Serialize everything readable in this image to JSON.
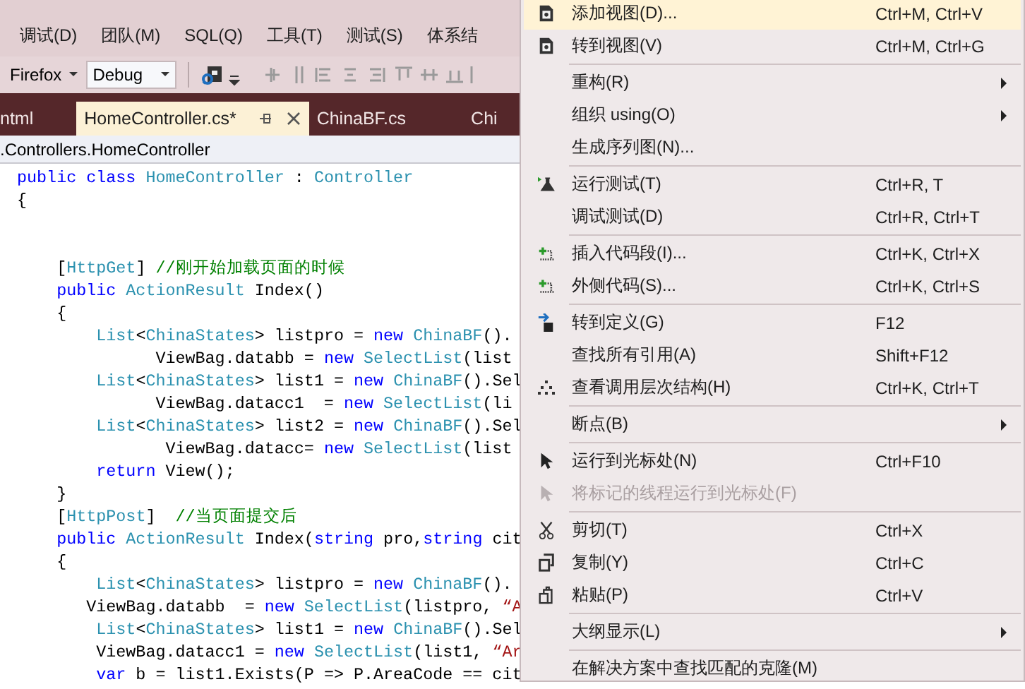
{
  "menu_bar": [
    "调试(D)",
    "团队(M)",
    "SQL(Q)",
    "工具(T)",
    "测试(S)",
    "体系结"
  ],
  "toolbar": {
    "browser": "Firefox",
    "configuration": "Debug"
  },
  "tabs": [
    {
      "label": "ntml",
      "selected": false
    },
    {
      "label": "HomeController.cs*",
      "selected": true
    },
    {
      "label": "ChinaBF.cs",
      "selected": false
    },
    {
      "label": "Chi",
      "selected": false
    }
  ],
  "breadcrumb": ".Controllers.HomeController",
  "code_lines": [
    {
      "tokens": [
        {
          "kind": "keyword",
          "text": " public class "
        },
        {
          "kind": "type",
          "text": "HomeController"
        },
        {
          "kind": "plain",
          "text": " : "
        },
        {
          "kind": "type",
          "text": "Controller"
        }
      ]
    },
    {
      "tokens": [
        {
          "kind": "plain",
          "text": " {"
        }
      ]
    },
    {
      "gap_before": true,
      "tokens": [
        {
          "kind": "plain",
          "text": "     ["
        },
        {
          "kind": "type",
          "text": "HttpGet"
        },
        {
          "kind": "plain",
          "text": "] "
        },
        {
          "kind": "comment",
          "text": "//刚开始加载页面的时候"
        }
      ]
    },
    {
      "tokens": [
        {
          "kind": "keyword",
          "text": "     public "
        },
        {
          "kind": "type",
          "text": "ActionResult"
        },
        {
          "kind": "plain",
          "text": " Index()"
        }
      ]
    },
    {
      "tokens": [
        {
          "kind": "plain",
          "text": "     {"
        }
      ]
    },
    {
      "tokens": [
        {
          "kind": "type",
          "text": "         List"
        },
        {
          "kind": "plain",
          "text": "<"
        },
        {
          "kind": "type",
          "text": "ChinaStates"
        },
        {
          "kind": "plain",
          "text": "> listpro = "
        },
        {
          "kind": "keyword",
          "text": "new "
        },
        {
          "kind": "type",
          "text": "ChinaBF"
        },
        {
          "kind": "plain",
          "text": "()."
        }
      ]
    },
    {
      "tokens": [
        {
          "kind": "plain",
          "text": "               ViewBag.databb = "
        },
        {
          "kind": "keyword",
          "text": "new "
        },
        {
          "kind": "type",
          "text": "SelectList"
        },
        {
          "kind": "plain",
          "text": "(list"
        }
      ]
    },
    {
      "tokens": [
        {
          "kind": "type",
          "text": "         List"
        },
        {
          "kind": "plain",
          "text": "<"
        },
        {
          "kind": "type",
          "text": "ChinaStates"
        },
        {
          "kind": "plain",
          "text": "> list1 = "
        },
        {
          "kind": "keyword",
          "text": "new "
        },
        {
          "kind": "type",
          "text": "ChinaBF"
        },
        {
          "kind": "plain",
          "text": "().Sel"
        }
      ]
    },
    {
      "tokens": [
        {
          "kind": "plain",
          "text": "               ViewBag.datacc1  = "
        },
        {
          "kind": "keyword",
          "text": "new "
        },
        {
          "kind": "type",
          "text": "SelectList"
        },
        {
          "kind": "plain",
          "text": "(li"
        }
      ]
    },
    {
      "tokens": [
        {
          "kind": "type",
          "text": "         List"
        },
        {
          "kind": "plain",
          "text": "<"
        },
        {
          "kind": "type",
          "text": "ChinaStates"
        },
        {
          "kind": "plain",
          "text": "> list2 = "
        },
        {
          "kind": "keyword",
          "text": "new "
        },
        {
          "kind": "type",
          "text": "ChinaBF"
        },
        {
          "kind": "plain",
          "text": "().Sel"
        }
      ]
    },
    {
      "tokens": [
        {
          "kind": "plain",
          "text": "                ViewBag.datacc= "
        },
        {
          "kind": "keyword",
          "text": "new "
        },
        {
          "kind": "type",
          "text": "SelectList"
        },
        {
          "kind": "plain",
          "text": "(list"
        }
      ]
    },
    {
      "tokens": [
        {
          "kind": "keyword",
          "text": "         return"
        },
        {
          "kind": "plain",
          "text": " View();"
        }
      ]
    },
    {
      "tokens": [
        {
          "kind": "plain",
          "text": "     }"
        }
      ]
    },
    {
      "tokens": [
        {
          "kind": "plain",
          "text": "     ["
        },
        {
          "kind": "type",
          "text": "HttpPost"
        },
        {
          "kind": "plain",
          "text": "]  "
        },
        {
          "kind": "comment",
          "text": "//当页面提交后"
        }
      ]
    },
    {
      "tokens": [
        {
          "kind": "keyword",
          "text": "     public "
        },
        {
          "kind": "type",
          "text": "ActionResult"
        },
        {
          "kind": "plain",
          "text": " Index("
        },
        {
          "kind": "keyword",
          "text": "string"
        },
        {
          "kind": "plain",
          "text": " pro,"
        },
        {
          "kind": "keyword",
          "text": "string"
        },
        {
          "kind": "plain",
          "text": " cit"
        }
      ]
    },
    {
      "tokens": [
        {
          "kind": "plain",
          "text": "     {"
        }
      ]
    },
    {
      "tokens": [
        {
          "kind": "type",
          "text": "         List"
        },
        {
          "kind": "plain",
          "text": "<"
        },
        {
          "kind": "type",
          "text": "ChinaStates"
        },
        {
          "kind": "plain",
          "text": "> listpro = "
        },
        {
          "kind": "keyword",
          "text": "new "
        },
        {
          "kind": "type",
          "text": "ChinaBF"
        },
        {
          "kind": "plain",
          "text": "()."
        }
      ]
    },
    {
      "tokens": [
        {
          "kind": "plain",
          "text": "        ViewBag.databb  = "
        },
        {
          "kind": "keyword",
          "text": "new "
        },
        {
          "kind": "type",
          "text": "SelectList"
        },
        {
          "kind": "plain",
          "text": "(listpro, "
        },
        {
          "kind": "string",
          "text": "“A"
        }
      ]
    },
    {
      "tokens": [
        {
          "kind": "type",
          "text": "         List"
        },
        {
          "kind": "plain",
          "text": "<"
        },
        {
          "kind": "type",
          "text": "ChinaStates"
        },
        {
          "kind": "plain",
          "text": "> list1 = "
        },
        {
          "kind": "keyword",
          "text": "new "
        },
        {
          "kind": "type",
          "text": "ChinaBF"
        },
        {
          "kind": "plain",
          "text": "().Sel"
        }
      ]
    },
    {
      "tokens": [
        {
          "kind": "plain",
          "text": "         ViewBag.datacc1 = "
        },
        {
          "kind": "keyword",
          "text": "new "
        },
        {
          "kind": "type",
          "text": "SelectList"
        },
        {
          "kind": "plain",
          "text": "(list1, "
        },
        {
          "kind": "string",
          "text": "“Ar"
        }
      ]
    },
    {
      "tokens": [
        {
          "kind": "keyword",
          "text": "         var"
        },
        {
          "kind": "plain",
          "text": " b = list1.Exists(P => P.AreaCode == cit"
        }
      ]
    }
  ],
  "context_menu": [
    {
      "kind": "item",
      "label": "添加视图(D)...",
      "shortcut": "Ctrl+M, Ctrl+V",
      "selected": true,
      "disabled": false,
      "submenu": false
    },
    {
      "kind": "item",
      "label": "转到视图(V)",
      "shortcut": "Ctrl+M, Ctrl+G",
      "selected": false,
      "disabled": false,
      "submenu": false
    },
    {
      "kind": "separator"
    },
    {
      "kind": "item",
      "label": "重构(R)",
      "selected": false,
      "disabled": false,
      "submenu": true
    },
    {
      "kind": "item",
      "label": "组织 using(O)",
      "selected": false,
      "disabled": false,
      "submenu": true
    },
    {
      "kind": "item",
      "label": "生成序列图(N)...",
      "selected": false,
      "disabled": false,
      "submenu": false
    },
    {
      "kind": "separator"
    },
    {
      "kind": "item",
      "label": "运行测试(T)",
      "shortcut": "Ctrl+R, T",
      "selected": false,
      "disabled": false,
      "submenu": false
    },
    {
      "kind": "item",
      "label": "调试测试(D)",
      "shortcut": "Ctrl+R, Ctrl+T",
      "selected": false,
      "disabled": false,
      "submenu": false
    },
    {
      "kind": "separator"
    },
    {
      "kind": "item",
      "label": "插入代码段(I)...",
      "shortcut": "Ctrl+K, Ctrl+X",
      "selected": false,
      "disabled": false,
      "submenu": false
    },
    {
      "kind": "item",
      "label": "外侧代码(S)...",
      "shortcut": "Ctrl+K, Ctrl+S",
      "selected": false,
      "disabled": false,
      "submenu": false
    },
    {
      "kind": "separator"
    },
    {
      "kind": "item",
      "label": "转到定义(G)",
      "shortcut": "F12",
      "selected": false,
      "disabled": false,
      "submenu": false
    },
    {
      "kind": "item",
      "label": "查找所有引用(A)",
      "shortcut": "Shift+F12",
      "selected": false,
      "disabled": false,
      "submenu": false
    },
    {
      "kind": "item",
      "label": "查看调用层次结构(H)",
      "shortcut": "Ctrl+K, Ctrl+T",
      "selected": false,
      "disabled": false,
      "submenu": false
    },
    {
      "kind": "separator"
    },
    {
      "kind": "item",
      "label": "断点(B)",
      "selected": false,
      "disabled": false,
      "submenu": true
    },
    {
      "kind": "separator"
    },
    {
      "kind": "item",
      "label": "运行到光标处(N)",
      "shortcut": "Ctrl+F10",
      "selected": false,
      "disabled": false,
      "submenu": false
    },
    {
      "kind": "item",
      "label": "将标记的线程运行到光标处(F)",
      "selected": false,
      "disabled": true,
      "submenu": false
    },
    {
      "kind": "separator"
    },
    {
      "kind": "item",
      "label": "剪切(T)",
      "shortcut": "Ctrl+X",
      "selected": false,
      "disabled": false,
      "submenu": false
    },
    {
      "kind": "item",
      "label": "复制(Y)",
      "shortcut": "Ctrl+C",
      "selected": false,
      "disabled": false,
      "submenu": false
    },
    {
      "kind": "item",
      "label": "粘贴(P)",
      "shortcut": "Ctrl+V",
      "selected": false,
      "disabled": false,
      "submenu": false
    },
    {
      "kind": "separator"
    },
    {
      "kind": "item",
      "label": "大纲显示(L)",
      "selected": false,
      "disabled": false,
      "submenu": true
    },
    {
      "kind": "separator"
    },
    {
      "kind": "item",
      "label": "在解决方案中查找匹配的克隆(M)",
      "selected": false,
      "disabled": false,
      "submenu": false
    }
  ]
}
